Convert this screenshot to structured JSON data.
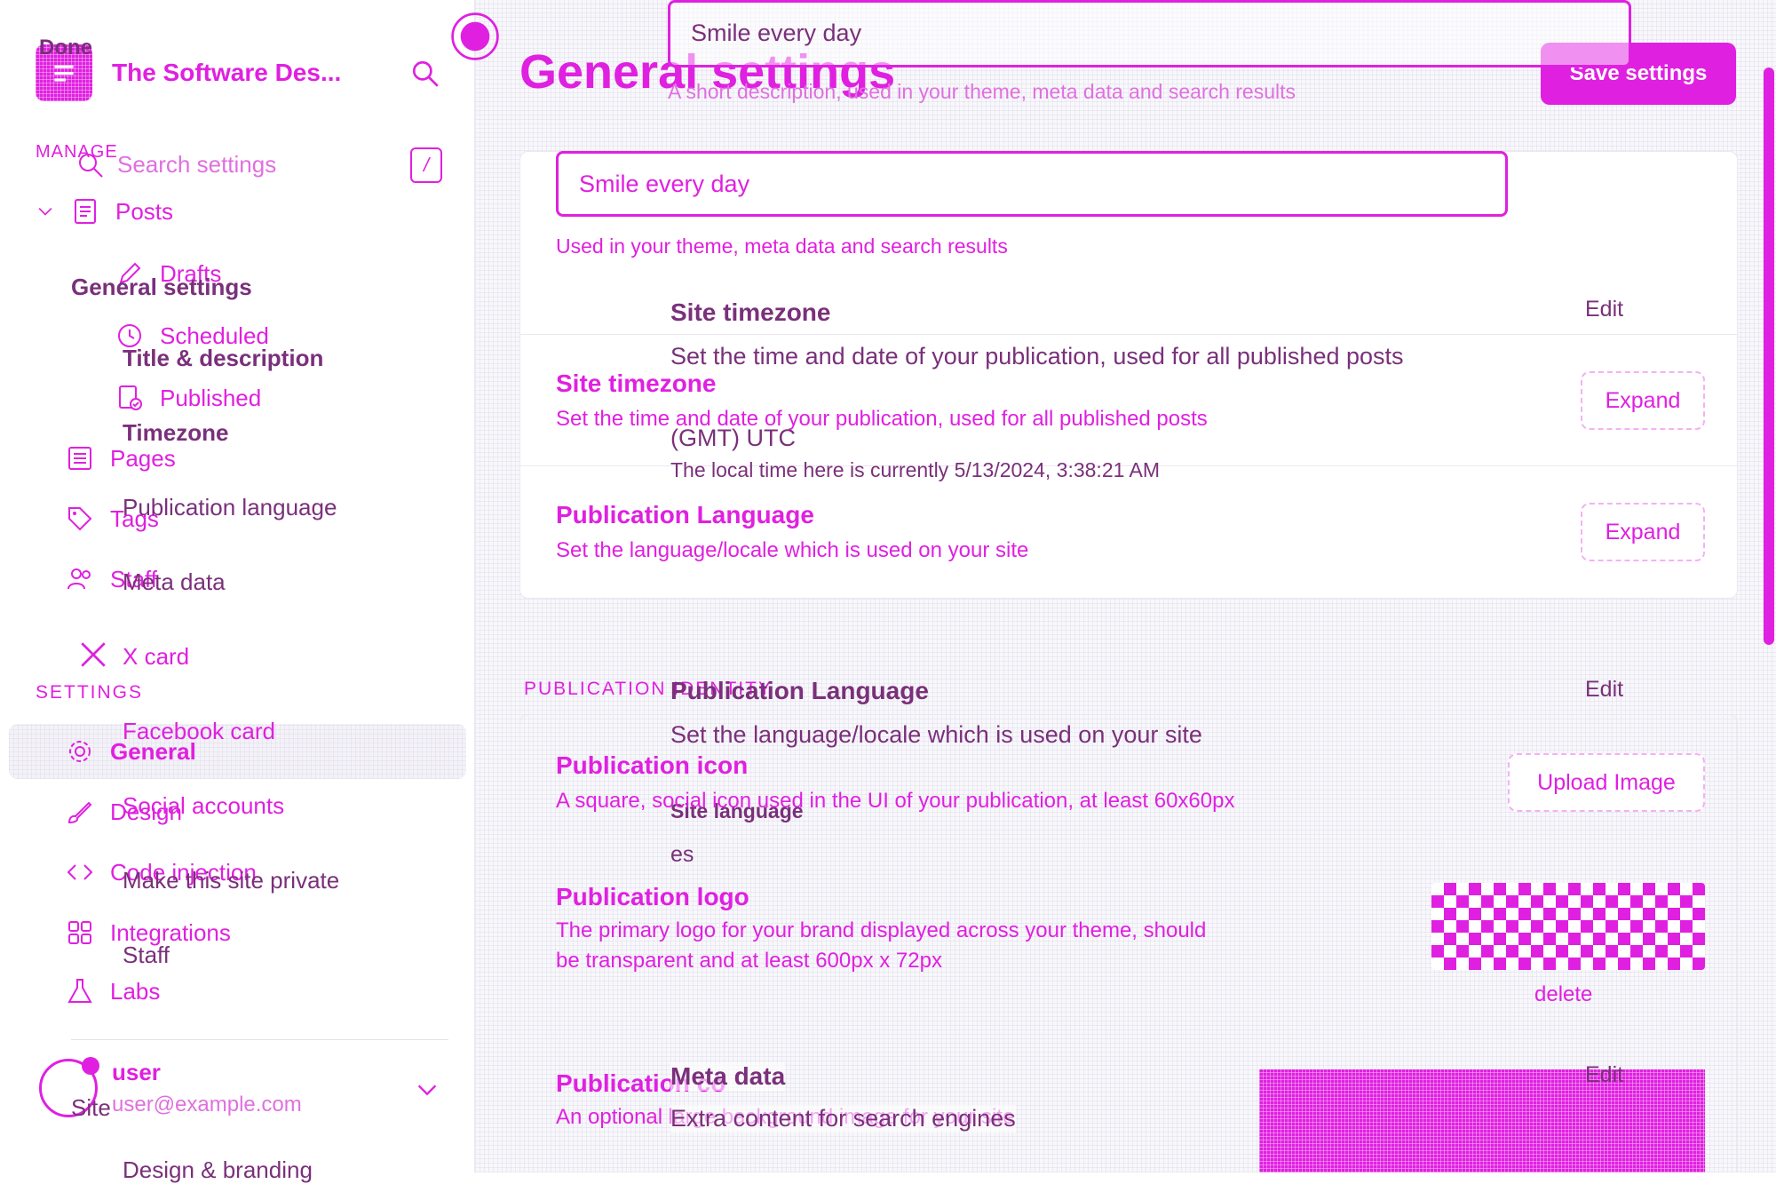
{
  "app": {
    "workspace": "The Software Des...",
    "done_label": "Done"
  },
  "search": {
    "placeholder": "Search settings",
    "shortcut": "/"
  },
  "sidebar": {
    "manage_label": "MANAGE",
    "posts": "Posts",
    "drafts": "Drafts",
    "scheduled": "Scheduled",
    "published": "Published",
    "pages": "Pages",
    "tags": "Tags",
    "staff": "Staff",
    "settings_label": "SETTINGS",
    "general": "General",
    "design": "Design",
    "code_injection": "Code injection",
    "integrations": "Integrations",
    "labs": "Labs",
    "user_name": "user",
    "user_email": "user@example.com"
  },
  "overlay_nav": {
    "general_settings": "General settings",
    "title_description": "Title & description",
    "timezone": "Timezone",
    "publication_language": "Publication language",
    "meta_data": "Meta data",
    "x_card": "X card",
    "facebook_card": "Facebook card",
    "social_accounts": "Social accounts",
    "make_private": "Make this site private",
    "staff": "Staff",
    "site_label": "Site",
    "design_branding": "Design & branding"
  },
  "header": {
    "title": "General settings",
    "save_label": "Save settings",
    "desc_value": "Smile every day",
    "desc_hint": "A short description, used in your theme, meta data and search results"
  },
  "description_card": {
    "value": "Smile every day",
    "hint": "Used in your theme, meta data and search results"
  },
  "timezone": {
    "title": "Site timezone",
    "desc": "Set the time and date of your publication, used for all published posts",
    "expand": "Expand",
    "edit": "Edit",
    "value": "(GMT) UTC",
    "local_time": "The local time here is currently 5/13/2024, 3:38:21 AM"
  },
  "language": {
    "title": "Publication Language",
    "desc": "Set the language/locale which is used on your site",
    "expand": "Expand",
    "edit": "Edit",
    "site_language_label": "Site language",
    "site_language_value": "es"
  },
  "identity": {
    "section_label": "PUBLICATION IDENTITY",
    "icon_title": "Publication icon",
    "icon_desc": "A square, social icon used in the UI of your publication, at least 60x60px",
    "upload_label": "Upload Image",
    "logo_title": "Publication logo",
    "logo_desc_1": "The primary logo for your brand displayed across your theme, should",
    "logo_desc_2": "be transparent and at least 600px x 72px",
    "delete_label": "delete",
    "cover_title": "Publication cover",
    "cover_desc": "An optional large background image for your site"
  },
  "meta": {
    "title": "Meta data",
    "desc": "Extra content for search engines",
    "edit": "Edit"
  },
  "colors": {
    "accent": "#e020e0"
  }
}
